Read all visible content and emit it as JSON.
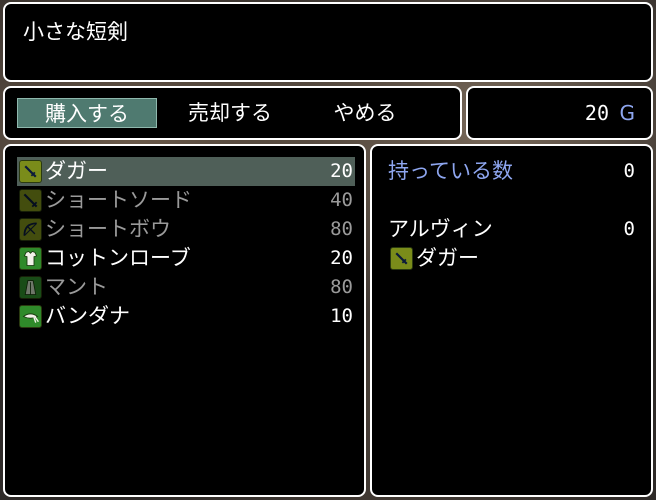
{
  "help": {
    "text": "小さな短剣"
  },
  "commands": {
    "buy": "購入する",
    "sell": "売却する",
    "cancel": "やめる"
  },
  "gold": {
    "value": "20",
    "unit": "G"
  },
  "items": [
    {
      "name": "ダガー",
      "price": "20",
      "icon": "dagger-icon",
      "enabled": true,
      "selected": true
    },
    {
      "name": "ショートソード",
      "price": "40",
      "icon": "sword-icon",
      "enabled": false,
      "selected": false
    },
    {
      "name": "ショートボウ",
      "price": "80",
      "icon": "bow-icon",
      "enabled": false,
      "selected": false
    },
    {
      "name": "コットンローブ",
      "price": "20",
      "icon": "robe-icon",
      "enabled": true,
      "selected": false
    },
    {
      "name": "マント",
      "price": "80",
      "icon": "cloak-icon",
      "enabled": false,
      "selected": false
    },
    {
      "name": "バンダナ",
      "price": "10",
      "icon": "bandana-icon",
      "enabled": true,
      "selected": false
    }
  ],
  "status": {
    "possession_label": "持っている数",
    "possession_value": "0",
    "actor_name": "アルヴィン",
    "actor_value": "0",
    "equipped_item": "ダガー",
    "equipped_icon": "dagger-icon"
  },
  "colors": {
    "system": "#8ea6f0",
    "selection": "#4f7a70",
    "icon_bg": "#7a8c1a"
  }
}
